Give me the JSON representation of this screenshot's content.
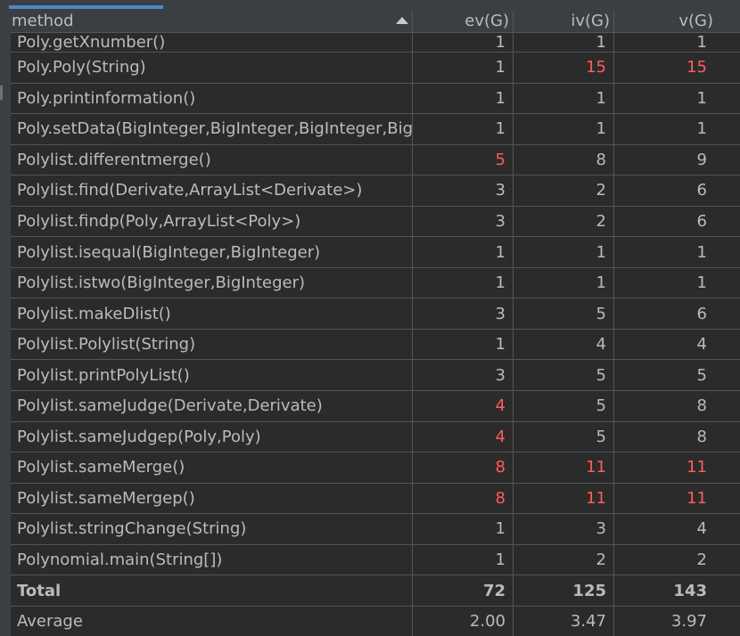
{
  "header": {
    "method": "method",
    "ev": "ev(G)",
    "iv": "iv(G)",
    "v": "v(G)",
    "sort_icon": "sort-ascending-icon"
  },
  "rows": [
    {
      "method": "Poly.getXnumber()",
      "ev": "1",
      "iv": "1",
      "v": "1"
    },
    {
      "method": "Poly.Poly(String)",
      "ev": "1",
      "iv": "15",
      "v": "15"
    },
    {
      "method": "Poly.printinformation()",
      "ev": "1",
      "iv": "1",
      "v": "1"
    },
    {
      "method": "Poly.setData(BigInteger,BigInteger,BigInteger,BigInt",
      "ev": "1",
      "iv": "1",
      "v": "1"
    },
    {
      "method": "Polylist.differentmerge()",
      "ev": "5",
      "iv": "8",
      "v": "9"
    },
    {
      "method": "Polylist.find(Derivate,ArrayList<Derivate>)",
      "ev": "3",
      "iv": "2",
      "v": "6"
    },
    {
      "method": "Polylist.findp(Poly,ArrayList<Poly>)",
      "ev": "3",
      "iv": "2",
      "v": "6"
    },
    {
      "method": "Polylist.isequal(BigInteger,BigInteger)",
      "ev": "1",
      "iv": "1",
      "v": "1"
    },
    {
      "method": "Polylist.istwo(BigInteger,BigInteger)",
      "ev": "1",
      "iv": "1",
      "v": "1"
    },
    {
      "method": "Polylist.makeDlist()",
      "ev": "3",
      "iv": "5",
      "v": "6"
    },
    {
      "method": "Polylist.Polylist(String)",
      "ev": "1",
      "iv": "4",
      "v": "4"
    },
    {
      "method": "Polylist.printPolyList()",
      "ev": "3",
      "iv": "5",
      "v": "5"
    },
    {
      "method": "Polylist.sameJudge(Derivate,Derivate)",
      "ev": "4",
      "iv": "5",
      "v": "8"
    },
    {
      "method": "Polylist.sameJudgep(Poly,Poly)",
      "ev": "4",
      "iv": "5",
      "v": "8"
    },
    {
      "method": "Polylist.sameMerge()",
      "ev": "8",
      "iv": "11",
      "v": "11"
    },
    {
      "method": "Polylist.sameMergep()",
      "ev": "8",
      "iv": "11",
      "v": "11"
    },
    {
      "method": "Polylist.stringChange(String)",
      "ev": "1",
      "iv": "3",
      "v": "4"
    },
    {
      "method": "Polynomial.main(String[])",
      "ev": "1",
      "iv": "2",
      "v": "2"
    }
  ],
  "total": {
    "label": "Total",
    "ev": "72",
    "iv": "125",
    "v": "143"
  },
  "average": {
    "label": "Average",
    "ev": "2.00",
    "iv": "3.47",
    "v": "3.97"
  },
  "colors": {
    "warning": "#ff5c5c",
    "text": "#bbbbbb",
    "background": "#2b2b2b"
  }
}
